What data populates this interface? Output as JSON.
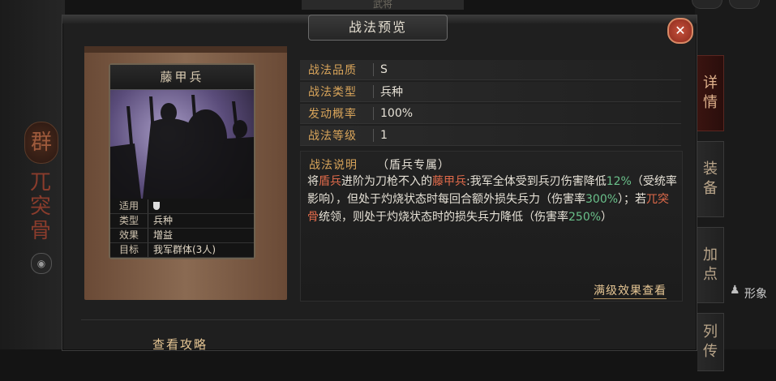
{
  "background": {
    "top_tab_label": "武将",
    "left_faction": "群",
    "left_name_chars": [
      "兀",
      "突",
      "骨"
    ],
    "side_tabs": [
      {
        "label": [
          "详",
          "情"
        ],
        "active": true
      },
      {
        "label": [
          "装",
          "备"
        ],
        "active": false
      },
      {
        "label": [
          "加",
          "点"
        ],
        "active": false
      },
      {
        "label": [
          "列",
          "传"
        ],
        "active": false
      }
    ],
    "person_label": "形象"
  },
  "dialog": {
    "title": "战法预览",
    "close_symbol": "✕"
  },
  "card": {
    "title": "藤甲兵",
    "props": [
      {
        "label": "适用",
        "value": ""
      },
      {
        "label": "类型",
        "value": "兵种"
      },
      {
        "label": "效果",
        "value": "增益"
      },
      {
        "label": "目标",
        "value": "我军群体(3人)"
      }
    ]
  },
  "info": {
    "rows": [
      {
        "label": "战法品质",
        "value": "S"
      },
      {
        "label": "战法类型",
        "value": "兵种"
      },
      {
        "label": "发动概率",
        "value": "100%"
      },
      {
        "label": "战法等级",
        "value": "1"
      }
    ],
    "desc_label": "战法说明",
    "desc_tag": "（盾兵专属）",
    "desc_parts": [
      {
        "text": "将",
        "color": "normal"
      },
      {
        "text": "盾兵",
        "color": "red"
      },
      {
        "text": "进阶为刀枪不入的",
        "color": "normal"
      },
      {
        "text": "藤甲兵",
        "color": "red"
      },
      {
        "text": ":我军全体受到兵刃伤害降低",
        "color": "normal"
      },
      {
        "text": "12%",
        "color": "green"
      },
      {
        "text": "（受统率影响），但处于灼烧状态时每回合额外损失兵力（伤害率",
        "color": "normal"
      },
      {
        "text": "300%",
        "color": "green"
      },
      {
        "text": "）；若",
        "color": "normal"
      },
      {
        "text": "兀突骨",
        "color": "red"
      },
      {
        "text": "统领，则处于灼烧状态时的损失兵力降低（伤害率",
        "color": "normal"
      },
      {
        "text": "250%",
        "color": "green"
      },
      {
        "text": "）",
        "color": "normal"
      }
    ],
    "full_level_link": "满级效果查看"
  },
  "footer": {
    "guide_link": "查看攻略"
  }
}
